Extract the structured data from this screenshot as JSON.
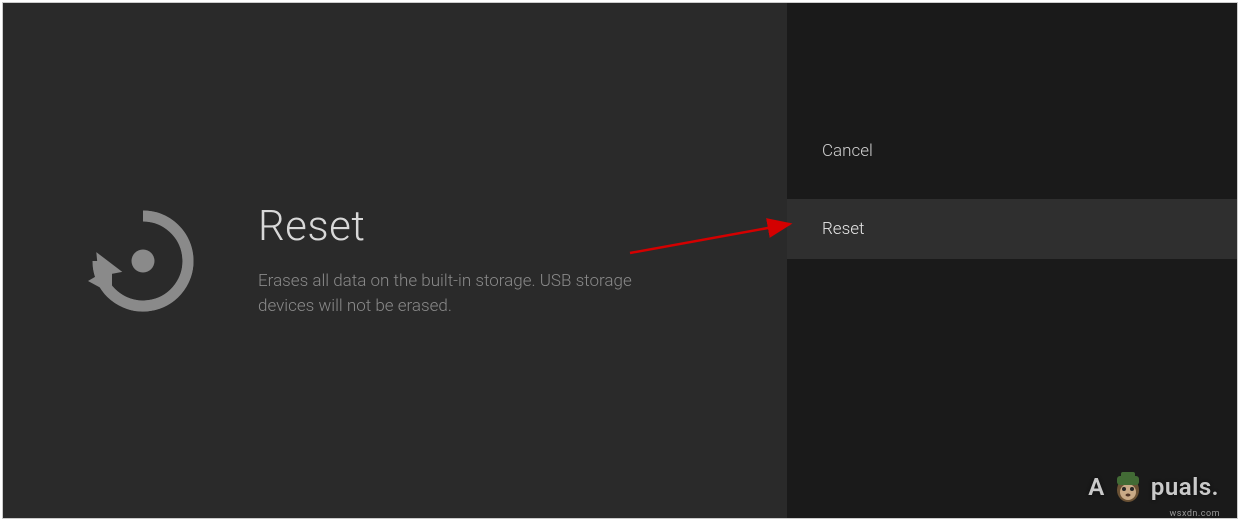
{
  "left": {
    "title": "Reset",
    "description": "Erases all data on the built-in storage. USB storage devices will not be erased."
  },
  "right": {
    "items": [
      {
        "label": "Cancel",
        "selected": false
      },
      {
        "label": "Reset",
        "selected": true
      }
    ]
  },
  "watermark": {
    "prefix": "A",
    "suffix": "puals."
  },
  "domain": "wsxdn.com"
}
